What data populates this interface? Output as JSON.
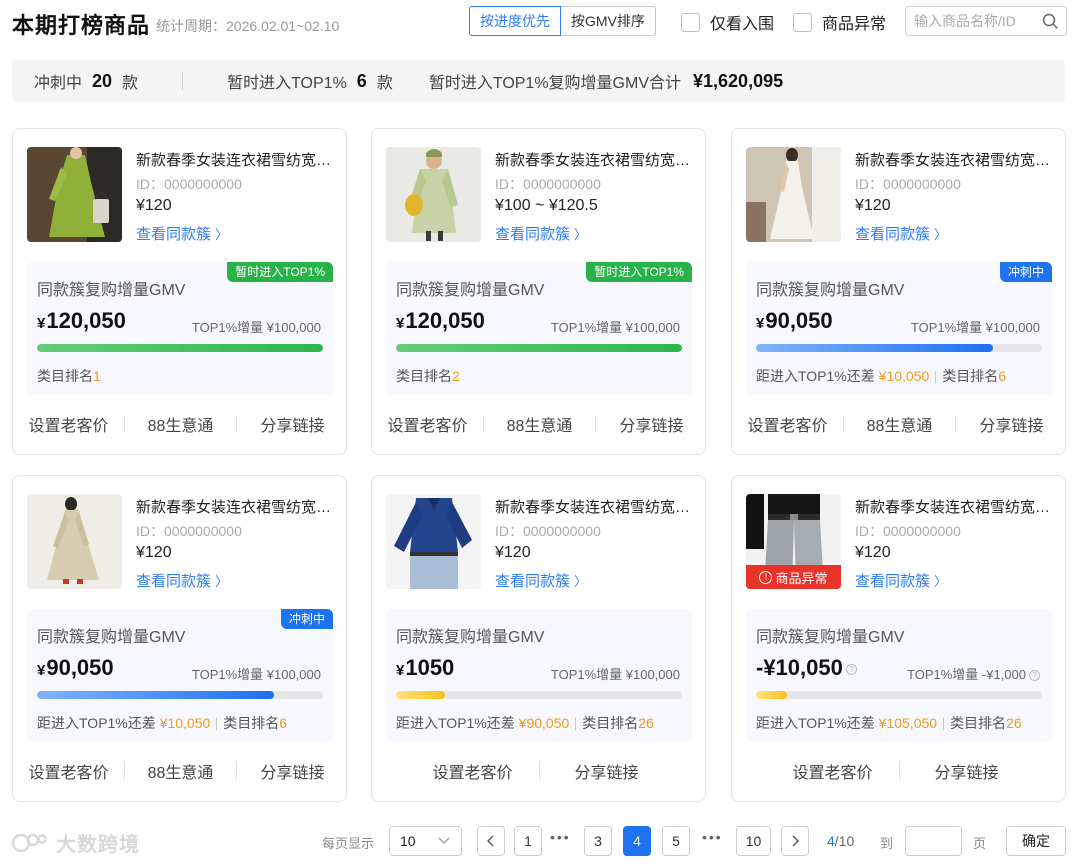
{
  "header": {
    "title": "本期打榜商品",
    "period": "统计周期：2026.02.01~02.10",
    "sort_progress": "按进度优先",
    "sort_gmv": "按GMV排序",
    "filter_shortlisted": "仅看入围",
    "filter_abnormal": "商品异常",
    "search_placeholder": "输入商品名称/ID"
  },
  "stats": {
    "sprinting_label": "冲刺中",
    "sprinting_count": "20",
    "sprinting_unit": "款",
    "top_label": "暂时进入TOP1%",
    "top_count": "6",
    "top_unit": "款",
    "gmv_label": "暂时进入TOP1%复购增量GMV合计",
    "gmv_value": "¥1,620,095"
  },
  "cards": [
    {
      "title": "新款春季女装连衣裙雪纺宽松显瘦长裙",
      "id": "ID：0000000000",
      "price": "¥120",
      "link": "查看同款簇",
      "panel_title": "同款簇复购增量GMV",
      "tag": "暂时进入TOP1%",
      "tag_color": "#27b34a",
      "gmv": "120,050",
      "top1": "TOP1%增量 ¥100,000",
      "progress": 1.0,
      "bar_color": "green",
      "gap_label": "",
      "gap_value": "",
      "rank_label": "类目排名",
      "rank_value": "1",
      "actions": [
        "设置老客价",
        "88生意通",
        "分享链接"
      ],
      "icon": "green-dress-photo"
    },
    {
      "title": "新款春季女装连衣裙雪纺宽松显瘦长裙",
      "id": "ID：0000000000",
      "price": "¥100 ~ ¥120.5",
      "link": "查看同款簇",
      "panel_title": "同款簇复购增量GMV",
      "tag": "暂时进入TOP1%",
      "tag_color": "#27b34a",
      "gmv": "120,050",
      "top1": "TOP1%增量 ¥100,000",
      "progress": 1.0,
      "bar_color": "green",
      "gap_label": "",
      "gap_value": "",
      "rank_label": "类目排名",
      "rank_value": "2",
      "actions": [
        "设置老客价",
        "88生意通",
        "分享链接"
      ],
      "icon": "light-coat-photo"
    },
    {
      "title": "新款春季女装连衣裙雪纺宽松显瘦长裙",
      "id": "ID：0000000000",
      "price": "¥120",
      "link": "查看同款簇",
      "panel_title": "同款簇复购增量GMV",
      "tag": "冲刺中",
      "tag_color": "#1d73f0",
      "gmv": "90,050",
      "top1": "TOP1%增量 ¥100,000",
      "progress": 0.83,
      "bar_color": "blue",
      "gap_label": "距进入TOP1%还差",
      "gap_value": "¥10,050",
      "rank_label": "类目排名",
      "rank_value": "6",
      "actions": [
        "设置老客价",
        "88生意通",
        "分享链接"
      ],
      "icon": "white-dress-photo"
    },
    {
      "title": "新款春季女装连衣裙雪纺宽松显瘦长裙",
      "id": "ID：0000000000",
      "price": "¥120",
      "link": "查看同款簇",
      "panel_title": "同款簇复购增量GMV",
      "tag": "冲刺中",
      "tag_color": "#1d73f0",
      "gmv": "90,050",
      "top1": "TOP1%增量 ¥100,000",
      "progress": 0.83,
      "bar_color": "blue",
      "gap_label": "距进入TOP1%还差",
      "gap_value": "¥10,050",
      "rank_label": "类目排名",
      "rank_value": "6",
      "actions": [
        "设置老客价",
        "88生意通",
        "分享链接"
      ],
      "icon": "beige-dress-photo"
    },
    {
      "title": "新款春季女装连衣裙雪纺宽松显瘦长裙",
      "id": "ID：0000000000",
      "price": "¥120",
      "link": "查看同款簇",
      "panel_title": "同款簇复购增量GMV",
      "tag": "",
      "tag_color": "",
      "gmv": "1050",
      "top1": "TOP1%增量 ¥100,000",
      "progress": 0.17,
      "bar_color": "yellow",
      "gap_label": "距进入TOP1%还差",
      "gap_value": "¥90,050",
      "rank_label": "类目排名",
      "rank_value": "26",
      "actions": [
        "设置老客价",
        "分享链接"
      ],
      "icon": "blue-shirt-photo"
    },
    {
      "title": "新款春季女装连衣裙雪纺宽松显瘦长裙",
      "id": "ID：0000000000",
      "price": "¥120",
      "link": "查看同款簇",
      "panel_title": "同款簇复购增量GMV",
      "tag": "",
      "tag_color": "",
      "gmv": "-¥10,050",
      "top1": "TOP1%增量 -¥1,000",
      "progress": 0.11,
      "bar_color": "yellow",
      "gap_label": "距进入TOP1%还差",
      "gap_value": "¥105,050",
      "rank_label": "类目排名",
      "rank_value": "26",
      "actions": [
        "设置老客价",
        "分享链接"
      ],
      "abnormal_badge": "商品异常",
      "icon": "grey-trousers-photo"
    }
  ],
  "pagination": {
    "per_page_label": "每页显示",
    "per_page_value": "10",
    "pages": [
      "1",
      "3",
      "4",
      "5",
      "10"
    ],
    "current": "4",
    "info_current": "4",
    "info_total": "/10",
    "goto_label": "到",
    "page_unit": "页",
    "confirm": "确定"
  },
  "watermark": "大数跨境"
}
